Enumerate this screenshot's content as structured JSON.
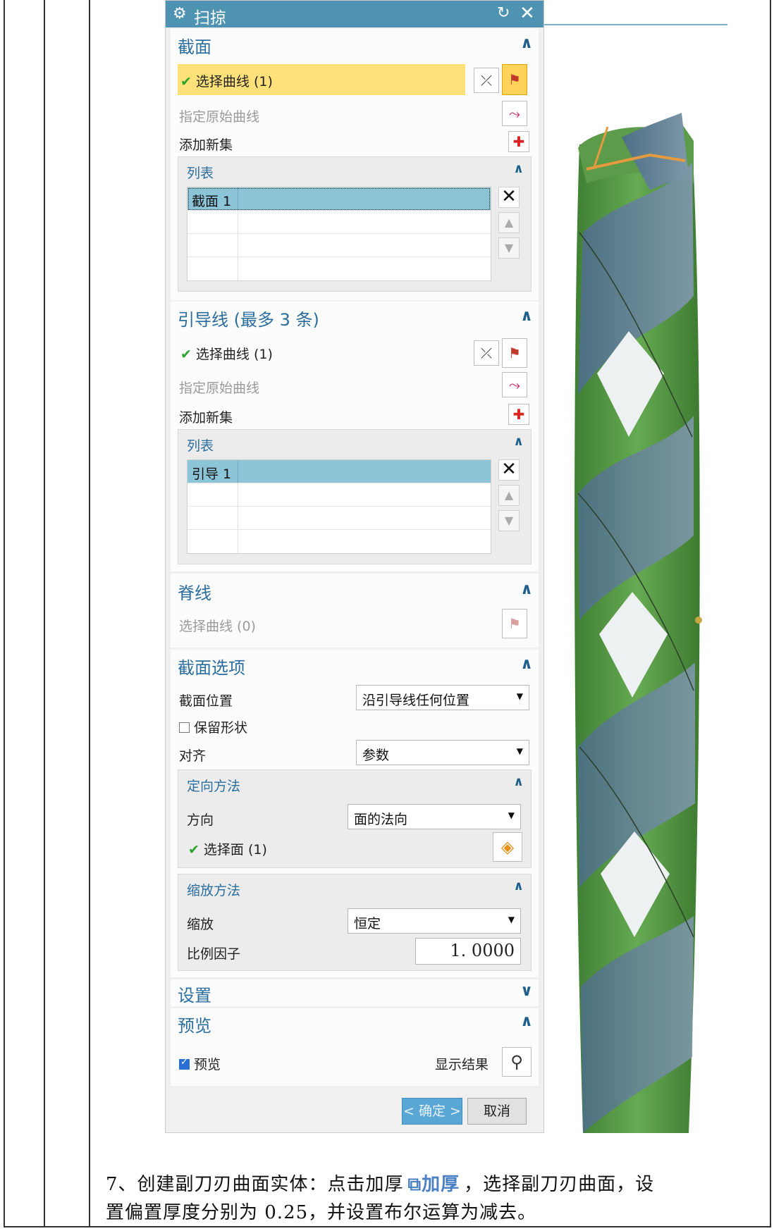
{
  "dialog": {
    "title": "扫掠",
    "gear_icon": "gear-icon",
    "reset_icon": "reset-icon",
    "close_icon": "close-icon"
  },
  "section_sections": {
    "title": "截面",
    "select_curve": "选择曲线 (1)",
    "specify_origin": "指定原始曲线",
    "add_new_set": "添加新集",
    "list_title": "列表",
    "list_items": [
      "截面 1"
    ]
  },
  "section_guides": {
    "title": "引导线 (最多 3 条)",
    "select_curve": "选择曲线 (1)",
    "specify_origin": "指定原始曲线",
    "add_new_set": "添加新集",
    "list_title": "列表",
    "list_items": [
      "引导 1"
    ]
  },
  "section_spine": {
    "title": "脊线",
    "select_curve": "选择曲线 (0)"
  },
  "section_options": {
    "title": "截面选项",
    "position_label": "截面位置",
    "position_value": "沿引导线任何位置",
    "preserve_shape": "保留形状",
    "preserve_checked": false,
    "align_label": "对齐",
    "align_value": "参数",
    "orientation_title": "定向方法",
    "direction_label": "方向",
    "direction_value": "面的法向",
    "select_face": "选择面 (1)",
    "scaling_title": "缩放方法",
    "scale_label": "缩放",
    "scale_value": "恒定",
    "factor_label": "比例因子",
    "factor_value": "1. 0000"
  },
  "section_settings": {
    "title": "设置"
  },
  "section_preview": {
    "title": "预览",
    "preview_label": "预览",
    "preview_checked": true,
    "show_result": "显示结果"
  },
  "buttons": {
    "ok": "< 确定 >",
    "cancel": "取消"
  },
  "caption": {
    "part1": "7、创建副刀刃曲面实体：点击加厚",
    "icon_label": "加厚",
    "part2": "，选择副刀刃曲面，设",
    "line2": "置偏置厚度分别为 0.25，并设置布尔运算为减去。"
  },
  "colors": {
    "title_bar": "#4f93b3",
    "highlight": "#ffe17a",
    "selected_row": "#8cc4d8",
    "model_green": "#5c9b4a",
    "model_blue": "#5d7f95"
  }
}
